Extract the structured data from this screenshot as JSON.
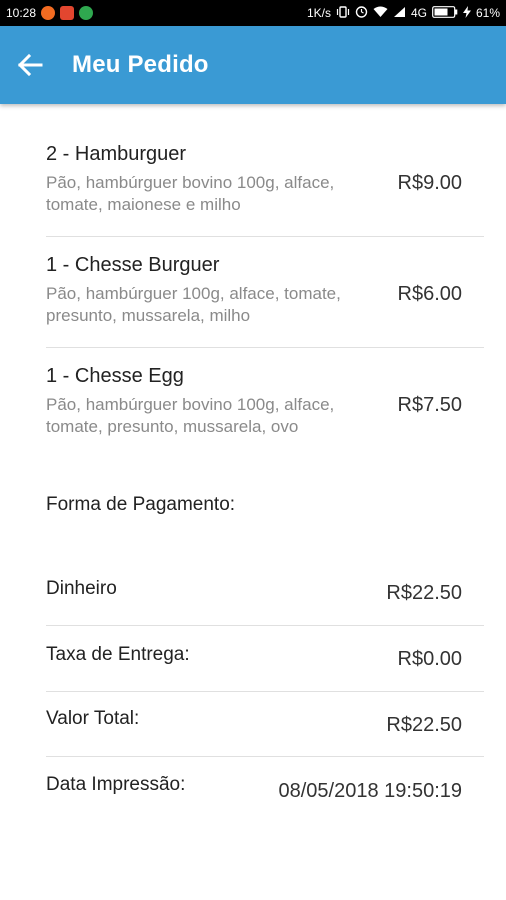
{
  "status_bar": {
    "time": "10:28",
    "network_speed": "1K/s",
    "network_type": "4G",
    "battery": "61%"
  },
  "appbar": {
    "back_icon": "arrow-left-icon",
    "title": "Meu Pedido"
  },
  "order_items": [
    {
      "name": "2 - Hamburguer",
      "description": "Pão, hambúrguer bovino 100g, alface, tomate, maionese e milho",
      "price": "R$9.00"
    },
    {
      "name": "1 - Chesse Burguer",
      "description": "Pão, hambúrguer 100g, alface, tomate, presunto, mussarela, milho",
      "price": "R$6.00"
    },
    {
      "name": "1 - Chesse Egg",
      "description": "Pão, hambúrguer bovino 100g, alface, tomate, presunto, mussarela, ovo",
      "price": "R$7.50"
    }
  ],
  "payment": {
    "heading": "Forma de Pagamento:",
    "method_label": "Dinheiro",
    "method_value": "R$22.50",
    "delivery_fee_label": "Taxa de Entrega:",
    "delivery_fee_value": "R$0.00",
    "total_label": "Valor Total:",
    "total_value": "R$22.50",
    "print_date_label": "Data Impressão:",
    "print_date_value": "08/05/2018 19:50:19"
  },
  "colors": {
    "appbar": "#3a9ad4",
    "status_bar": "#000000",
    "primary_text": "#222222",
    "secondary_text": "#8a8a8a",
    "divider": "#e0e0e0"
  }
}
